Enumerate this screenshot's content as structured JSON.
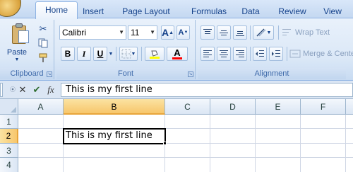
{
  "ribbon_tabs": [
    "Home",
    "Insert",
    "Page Layout",
    "Formulas",
    "Data",
    "Review",
    "View"
  ],
  "clipboard": {
    "paste_label": "Paste",
    "group_label": "Clipboard"
  },
  "font": {
    "family": "Calibri",
    "size": "11",
    "group_label": "Font",
    "bold_label": "B",
    "italic_label": "I",
    "underline_label": "U",
    "grow_label": "A",
    "shrink_label": "A",
    "color_label": "A",
    "font_color": "#ff0000",
    "highlight_color": "#ffff00"
  },
  "alignment": {
    "wrap_text_label": "Wrap Text",
    "merge_label": "Merge & Center",
    "group_label": "Alignment"
  },
  "formula_bar": {
    "fx_label": "fx",
    "content": "This is my first line"
  },
  "sheet": {
    "columns": [
      "A",
      "B",
      "C",
      "D",
      "E",
      "F"
    ],
    "rows": [
      "1",
      "2",
      "3",
      "4"
    ],
    "selected_column": "B",
    "selected_row": "2",
    "active_cell_value": "This is my first line"
  },
  "colors": {
    "selection_accent": "#f7c66b",
    "ribbon_text": "#15428b"
  }
}
